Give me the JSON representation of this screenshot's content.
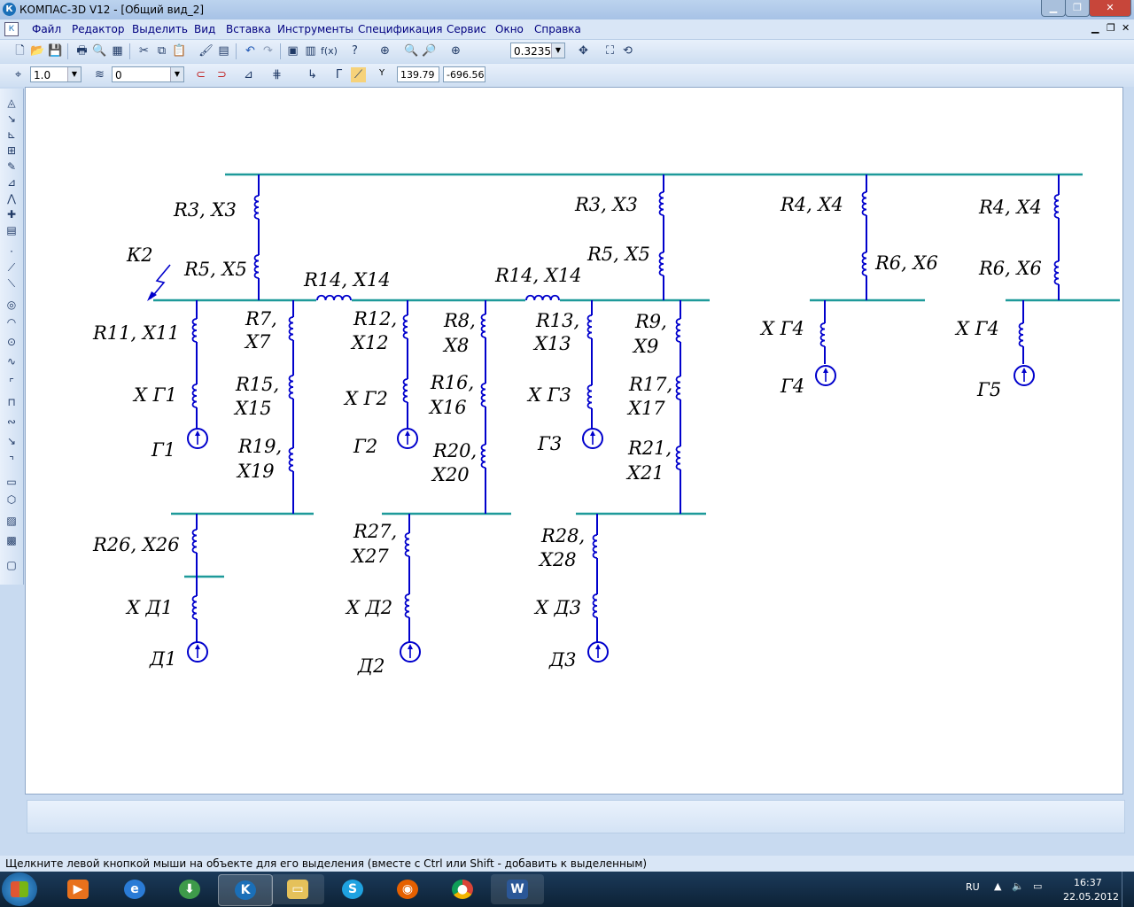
{
  "window": {
    "title": "КОМПАС-3D V12 - [Общий вид_2]",
    "app_icon": "К",
    "controls": [
      "minimize-icon",
      "maximize-icon",
      "close-icon"
    ]
  },
  "menu": [
    "Файл",
    "Редактор",
    "Выделить",
    "Вид",
    "Вставка",
    "Инструменты",
    "Спецификация",
    "Сервис",
    "Окно",
    "Справка"
  ],
  "toolbar": {
    "zoom_value": "0.3235"
  },
  "props": {
    "step": "1.0",
    "layer": "0",
    "coord_x": "139.79",
    "coord_y": "-696.56",
    "coord_label": "Y"
  },
  "statusbar": {
    "hint": "Щелкните левой кнопкой мыши на объекте для его выделения (вместе с Ctrl или Shift - добавить к выделенным)"
  },
  "tray": {
    "lang": "RU",
    "time": "16:37",
    "date": "22.05.2012"
  },
  "taskbar_apps": [
    "media-player",
    "internet-explorer",
    "downloader",
    "kompas",
    "explorer",
    "skype",
    "firefox",
    "chrome",
    "word"
  ],
  "colors": {
    "bus": "#1e9a9a",
    "wire": "#0000cc"
  },
  "diagram": {
    "labels": {
      "r3x3_a": "R3, X3",
      "r5x5_a": "R5, X5",
      "k2": "К2",
      "r14x14_a": "R14, X14",
      "r14x14_b": "R14, X14",
      "r3x3_b": "R3, X3",
      "r5x5_b": "R5, X5",
      "r4x4_a": "R4, X4",
      "r6x6_a": "R6, X6",
      "r4x4_b": "R4, X4",
      "r6x6_b": "R6, X6",
      "r11x11": "R11, X11",
      "xg1": "Х Г1",
      "g1": "Г1",
      "r7_1": "R7,",
      "r7_2": "X7",
      "r15_1": "R15,",
      "r15_2": "X15",
      "r19_1": "R19,",
      "r19_2": "X19",
      "r12_1": "R12,",
      "r12_2": "X12",
      "xg2": "Х Г2",
      "g2": "Г2",
      "r8_1": "R8,",
      "r8_2": "X8",
      "r16_1": "R16,",
      "r16_2": "X16",
      "r20_1": "R20,",
      "r20_2": "X20",
      "r13_1": "R13,",
      "r13_2": "X13",
      "xg3": "Х Г3",
      "g3": "Г3",
      "r9_1": "R9,",
      "r9_2": "X9",
      "r17_1": "R17,",
      "r17_2": "X17",
      "r21_1": "R21,",
      "r21_2": "X21",
      "xg4_a": "Х Г4",
      "g4": "Г4",
      "xg4_b": "Х Г4",
      "g5": "Г5",
      "r26x26": "R26, X26",
      "xd1": "Х Д1",
      "d1": "Д1",
      "r27_1": "R27,",
      "r27_2": "X27",
      "xd2": "Х Д2",
      "d2": "Д2",
      "r28_1": "R28,",
      "r28_2": "X28",
      "xd3": "Х Д3",
      "d3": "Д3"
    }
  }
}
